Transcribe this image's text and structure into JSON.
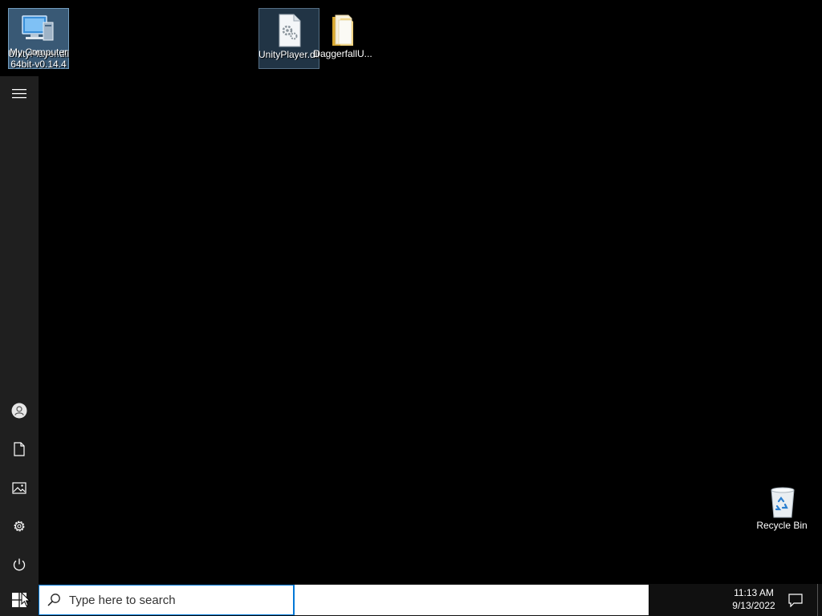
{
  "desktop": {
    "icons": [
      {
        "name": "my-computer",
        "label": "My Computer",
        "overlap_label": "UnityPlayer.dll 64bit-v0.14.4"
      },
      {
        "name": "unityplayer-dll",
        "label": "UnityPlayer.dll"
      },
      {
        "name": "daggerfall-folder",
        "label": "DaggerfallU..."
      },
      {
        "name": "recycle-bin",
        "label": "Recycle Bin"
      }
    ]
  },
  "start_rail": {
    "items": [
      {
        "name": "expand",
        "icon": "hamburger-icon"
      },
      {
        "name": "account",
        "icon": "user-icon"
      },
      {
        "name": "documents",
        "icon": "document-icon"
      },
      {
        "name": "pictures",
        "icon": "pictures-icon"
      },
      {
        "name": "settings",
        "icon": "gear-icon"
      },
      {
        "name": "power",
        "icon": "power-icon"
      }
    ]
  },
  "taskbar": {
    "search": {
      "placeholder": "Type here to search",
      "value": ""
    },
    "clock": {
      "time": "11:13 AM",
      "date": "9/13/2022"
    }
  },
  "colors": {
    "desktop_bg": "#000000",
    "rail_bg": "#1f1f1f",
    "taskbar_bg": "#101010",
    "accent": "#0078d7"
  }
}
